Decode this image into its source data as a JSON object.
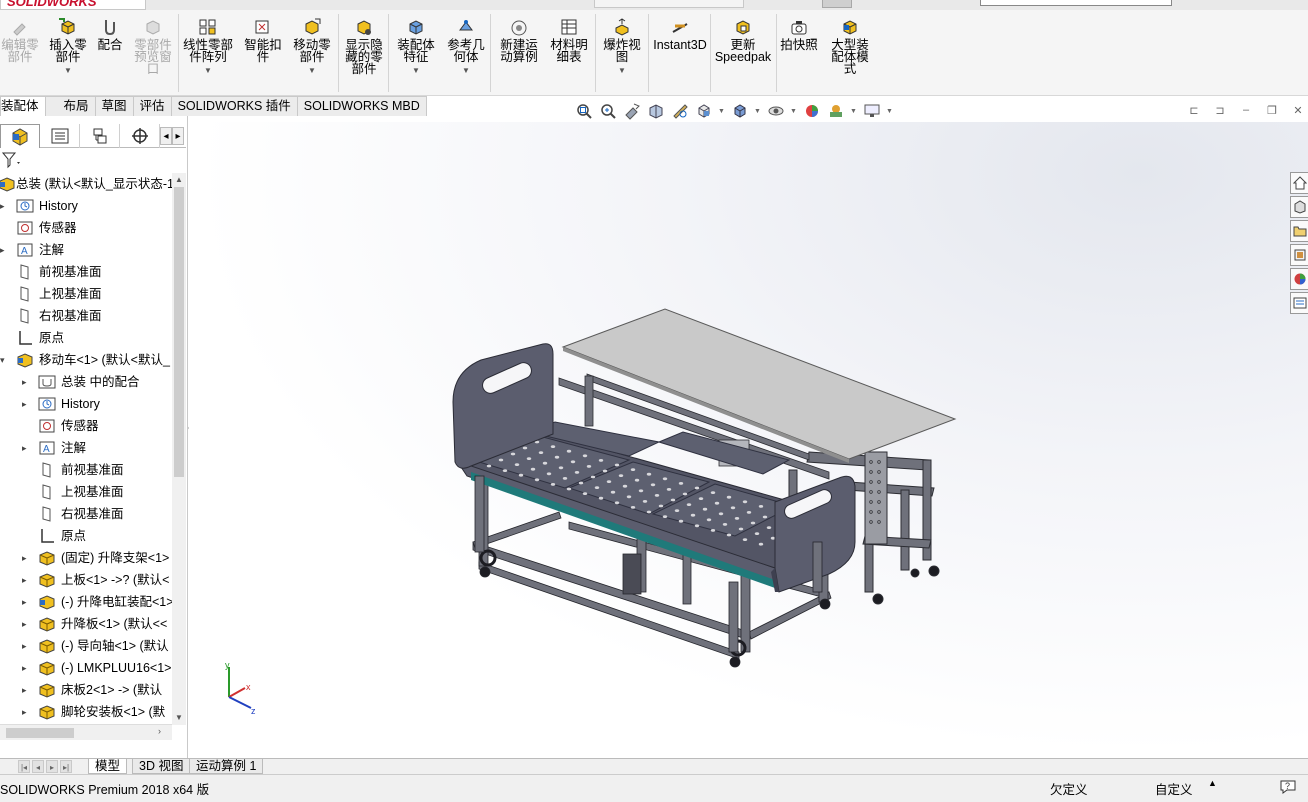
{
  "app": {
    "logo": "SOLIDWORKS",
    "status_version": "SOLIDWORKS Premium 2018 x64 版",
    "status_definition": "欠定义",
    "status_units": "自定义"
  },
  "commands": [
    {
      "label": "编辑零\n部件",
      "icon": "edit-component-icon",
      "disabled": true
    },
    {
      "label": "插入零\n部件",
      "icon": "insert-component-icon",
      "dropdown": true
    },
    {
      "label": "配合",
      "icon": "mate-icon"
    },
    {
      "label": "零部件\n预览窗\n口",
      "icon": "component-preview-icon",
      "disabled": true
    },
    {
      "label": "线性零部\n件阵列",
      "icon": "linear-pattern-icon",
      "dropdown": true
    },
    {
      "label": "智能扣\n件",
      "icon": "smart-fasteners-icon"
    },
    {
      "label": "移动零\n部件",
      "icon": "move-component-icon",
      "dropdown": true
    },
    {
      "label": "显示隐\n藏的零\n部件",
      "icon": "show-hidden-icon"
    },
    {
      "label": "装配体\n特征",
      "icon": "assembly-features-icon",
      "dropdown": true
    },
    {
      "label": "参考几\n何体",
      "icon": "reference-geometry-icon",
      "dropdown": true
    },
    {
      "label": "新建运\n动算例",
      "icon": "motion-study-icon"
    },
    {
      "label": "材料明\n细表",
      "icon": "bom-icon"
    },
    {
      "label": "爆炸视\n图",
      "icon": "exploded-view-icon",
      "dropdown": true
    },
    {
      "label": "Instant3D",
      "icon": "instant3d-icon"
    },
    {
      "label": "更新\nSpeedpak",
      "icon": "speedpak-icon"
    },
    {
      "label": "拍快照",
      "icon": "snapshot-icon"
    },
    {
      "label": "大型装\n配体模\n式",
      "icon": "large-assembly-icon"
    }
  ],
  "tabs": [
    "装配体",
    "布局",
    "草图",
    "评估",
    "SOLIDWORKS 插件",
    "SOLIDWORKS MBD"
  ],
  "tree": [
    {
      "label": "总装  (默认<默认_显示状态-1",
      "icon": "assembly-icon",
      "level": 0,
      "exp": "▾"
    },
    {
      "label": "History",
      "icon": "history-icon",
      "level": 1,
      "exp": "▸"
    },
    {
      "label": "传感器",
      "icon": "sensor-icon",
      "level": 1,
      "exp": ""
    },
    {
      "label": "注解",
      "icon": "annotation-icon",
      "level": 1,
      "exp": "▸"
    },
    {
      "label": "前视基准面",
      "icon": "plane-icon",
      "level": 1,
      "exp": ""
    },
    {
      "label": "上视基准面",
      "icon": "plane-icon",
      "level": 1,
      "exp": ""
    },
    {
      "label": "右视基准面",
      "icon": "plane-icon",
      "level": 1,
      "exp": ""
    },
    {
      "label": "原点",
      "icon": "origin-icon",
      "level": 1,
      "exp": ""
    },
    {
      "label": "移动车<1> (默认<默认_",
      "icon": "subassembly-icon",
      "level": 1,
      "exp": "▾"
    },
    {
      "label": "总装 中的配合",
      "icon": "mates-folder-icon",
      "level": 2,
      "exp": "▸"
    },
    {
      "label": "History",
      "icon": "history-icon",
      "level": 2,
      "exp": "▸"
    },
    {
      "label": "传感器",
      "icon": "sensor-icon",
      "level": 2,
      "exp": ""
    },
    {
      "label": "注解",
      "icon": "annotation-icon",
      "level": 2,
      "exp": "▸"
    },
    {
      "label": "前视基准面",
      "icon": "plane-icon",
      "level": 2,
      "exp": ""
    },
    {
      "label": "上视基准面",
      "icon": "plane-icon",
      "level": 2,
      "exp": ""
    },
    {
      "label": "右视基准面",
      "icon": "plane-icon",
      "level": 2,
      "exp": ""
    },
    {
      "label": "原点",
      "icon": "origin-icon",
      "level": 2,
      "exp": ""
    },
    {
      "label": "(固定) 升降支架<1>",
      "icon": "part-icon",
      "level": 2,
      "exp": "▸"
    },
    {
      "label": "上板<1> ->? (默认<",
      "icon": "part-icon",
      "level": 2,
      "exp": "▸"
    },
    {
      "label": "(-) 升降电缸装配<1>",
      "icon": "subassembly-icon",
      "level": 2,
      "exp": "▸"
    },
    {
      "label": "升降板<1> (默认<<",
      "icon": "part-icon",
      "level": 2,
      "exp": "▸"
    },
    {
      "label": "(-) 导向轴<1> (默认",
      "icon": "part-icon",
      "level": 2,
      "exp": "▸"
    },
    {
      "label": "(-) LMKPLUU16<1>",
      "icon": "part-icon",
      "level": 2,
      "exp": "▸"
    },
    {
      "label": "床板2<1> -> (默认",
      "icon": "part-icon",
      "level": 2,
      "exp": "▸"
    },
    {
      "label": "脚轮安装板<1> (默",
      "icon": "part-icon",
      "level": 2,
      "exp": "▸"
    }
  ],
  "bottom_tabs": [
    "模型",
    "3D 视图",
    "运动算例 1"
  ],
  "colors": {
    "accent_blue": "#1565c0",
    "model_panel": "#5b5d6e",
    "model_frame": "#6f717b",
    "model_top": "#c9c9c9"
  }
}
